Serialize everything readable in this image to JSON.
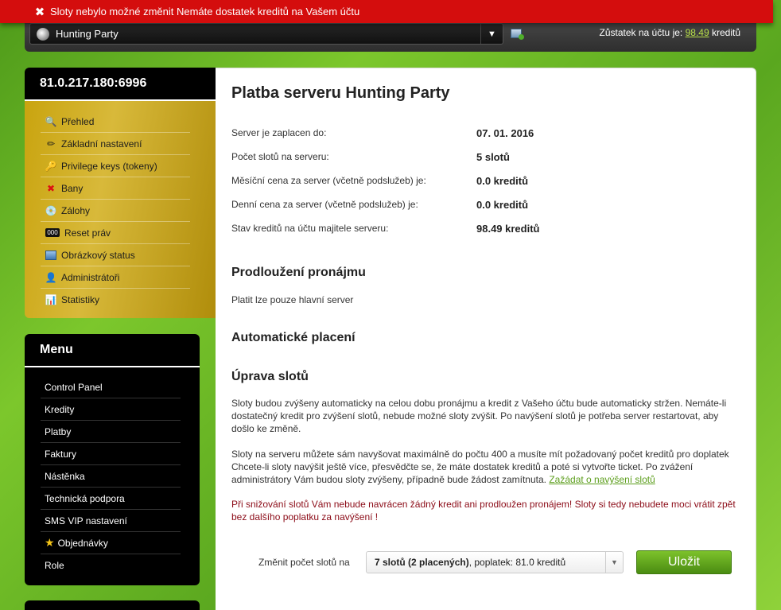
{
  "error": {
    "message": "Sloty nebylo možné změnit Nemáte dostatek kreditů na Vašem účtu"
  },
  "topbar": {
    "server_name": "Hunting Party",
    "balance_label": "Zůstatek na účtu je:",
    "balance_value": "98.49",
    "balance_unit": "kreditů"
  },
  "server_box": {
    "address": "81.0.217.180:6996",
    "items": [
      {
        "label": "Přehled",
        "icon": "magnifier-icon"
      },
      {
        "label": "Základní nastavení",
        "icon": "pencil-icon"
      },
      {
        "label": "Privilege keys (tokeny)",
        "icon": "key-icon"
      },
      {
        "label": "Bany",
        "icon": "red-x-icon"
      },
      {
        "label": "Zálohy",
        "icon": "disc-icon"
      },
      {
        "label": "Reset práv",
        "icon": "counter-icon"
      },
      {
        "label": "Obrázkový status",
        "icon": "image-icon"
      },
      {
        "label": "Administrátoři",
        "icon": "admin-icon"
      },
      {
        "label": "Statistiky",
        "icon": "chart-icon"
      }
    ]
  },
  "menu": {
    "title": "Menu",
    "items": [
      {
        "label": "Control Panel"
      },
      {
        "label": "Kredity"
      },
      {
        "label": "Platby"
      },
      {
        "label": "Faktury"
      },
      {
        "label": "Nástěnka"
      },
      {
        "label": "Technická podpora"
      },
      {
        "label": "SMS VIP nastavení"
      },
      {
        "label": "Objednávky",
        "icon": "star-icon"
      },
      {
        "label": "Role"
      }
    ]
  },
  "main": {
    "title": "Platba serveru Hunting Party",
    "rows": [
      {
        "key": "Server je zaplacen do:",
        "value": "07. 01. 2016"
      },
      {
        "key": "Počet slotů na serveru:",
        "value": "5 slotů"
      },
      {
        "key": "Měsíční cena za server (včetně podslužeb) je:",
        "value": "0.0 kreditů"
      },
      {
        "key": "Denní cena za server (včetně podslužeb) je:",
        "value": "0.0 kreditů"
      },
      {
        "key": "Stav kreditů na účtu majitele serveru:",
        "value": "98.49 kreditů"
      }
    ],
    "extension_title": "Prodloužení pronájmu",
    "extension_text": "Platit lze pouze hlavní server",
    "auto_title": "Automatické placení",
    "slots_title": "Úprava slotů",
    "slots_p1": "Sloty budou zvýšeny automaticky na celou dobu pronájmu a kredit z Vašeho účtu bude automaticky stržen. Nemáte-li dostatečný kredit pro zvýšení slotů, nebude možné sloty zvýšit. Po navýšení slotů je potřeba server restartovat, aby došlo ke změně.",
    "slots_p2": "Sloty na serveru můžete sám navyšovat maximálně do počtu 400 a musíte mít požadovaný počet kreditů pro doplatek Chcete-li sloty navýšit ještě více, přesvědčte se, že máte dostatek kreditů a poté si vytvořte ticket. Po zvážení administrátory Vám budou sloty zvýšeny, případně bude žádost zamítnuta.",
    "slots_link": "Zažádat o navýšení slotů",
    "slots_warn": "Při snižování slotů Vám nebude navrácen žádný kredit ani prodloužen pronájem! Sloty si tedy nebudete moci vrátit zpět bez dalšího poplatku za navýšení !",
    "change_label": "Změnit počet slotů na",
    "select_bold": "7 slotů (2 placených)",
    "select_rest": ", poplatek: 81.0 kreditů",
    "save_label": "Uložit"
  }
}
